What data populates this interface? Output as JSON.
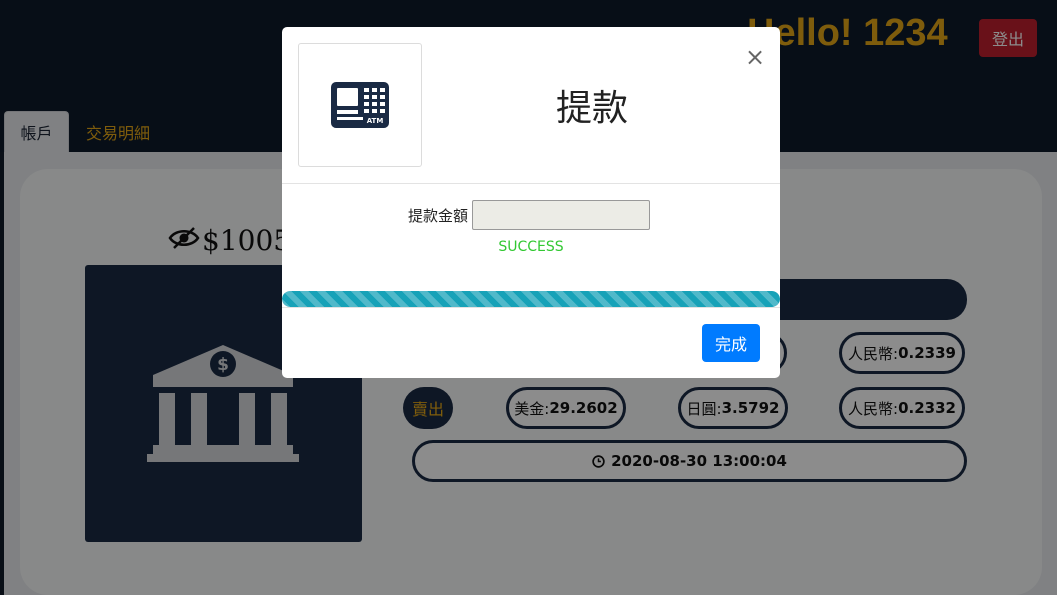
{
  "header": {
    "greeting": "Hello! 1234",
    "logout_label": "登出"
  },
  "tabs": [
    {
      "label": "帳戶",
      "active": true
    },
    {
      "label": "交易明細",
      "active": false
    }
  ],
  "account": {
    "balance": "$1005"
  },
  "rates": {
    "buy": {
      "cny": {
        "label": "人民幣:",
        "value": "0.2339"
      }
    },
    "sell": {
      "action_label": "賣出",
      "usd": {
        "label": "美金:",
        "value": "29.2602"
      },
      "jpy": {
        "label": "日圓:",
        "value": "3.5792"
      },
      "cny": {
        "label": "人民幣:",
        "value": "0.2332"
      }
    },
    "timestamp": "2020-08-30 13:00:04"
  },
  "modal": {
    "title": "提款",
    "close_glyph": "×",
    "amount_label": "提款金額",
    "amount_value": "",
    "status": "SUCCESS",
    "progress": 1.0,
    "done_label": "完成"
  },
  "colors": {
    "accent": "#e6a817",
    "navy": "#1a2a44",
    "danger": "#c0202e",
    "primary": "#007bff",
    "success": "#32c832",
    "progress": "#17a2b8"
  },
  "icons": {
    "atm": "atm-icon",
    "bank": "bank-icon",
    "eye_slash": "eye-slash-icon",
    "clock": "clock-icon",
    "close": "close-icon"
  }
}
